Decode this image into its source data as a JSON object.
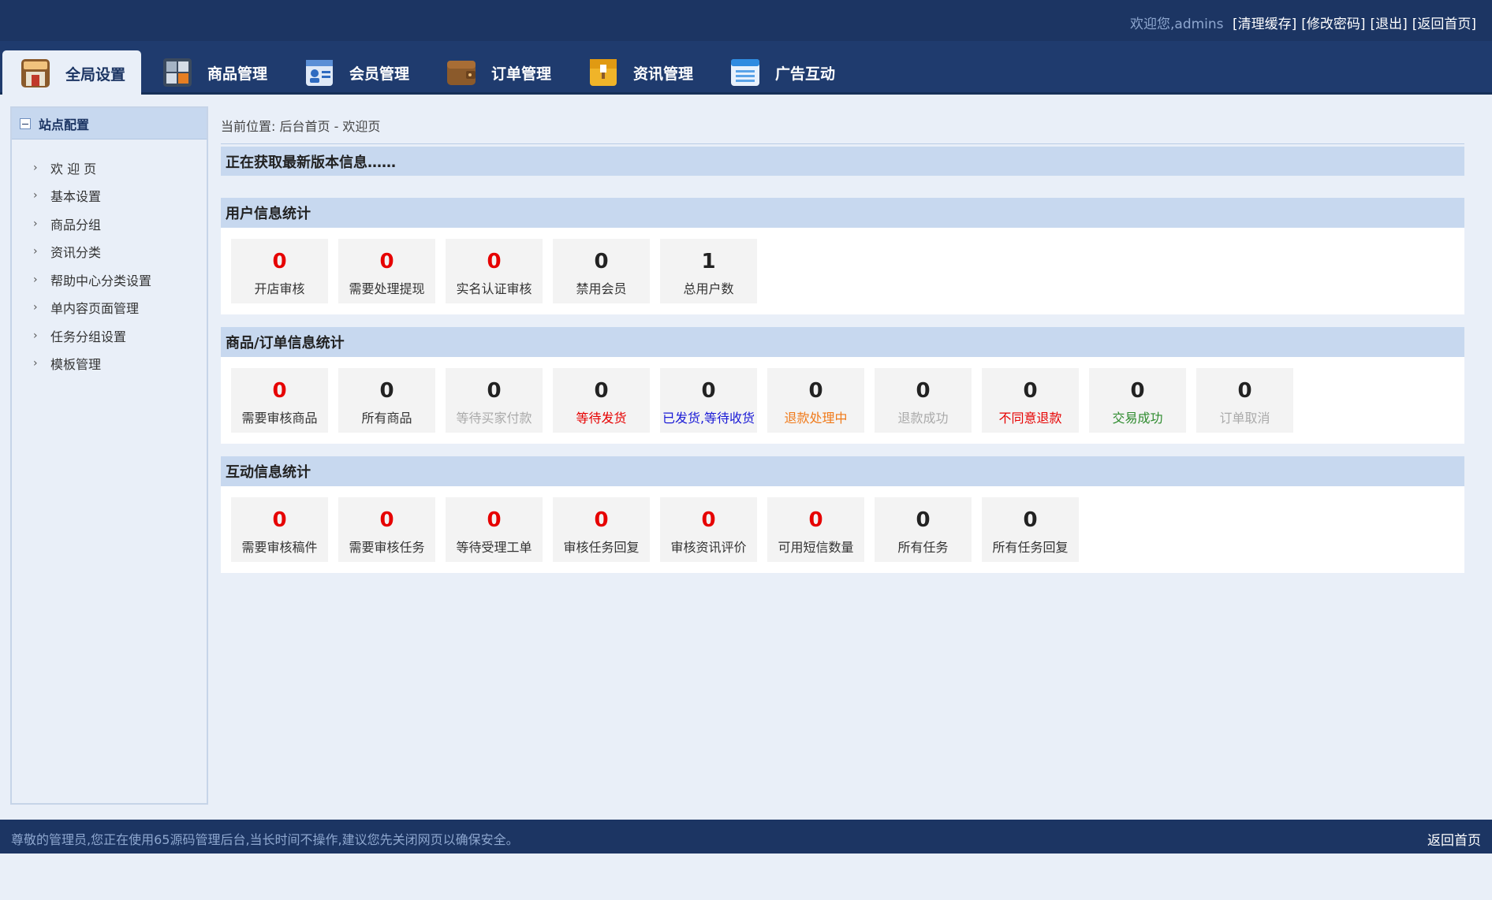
{
  "topbar": {
    "welcome": "欢迎您,",
    "username": "admins",
    "links": [
      "[清理缓存]",
      "[修改密码]",
      "[退出]",
      "[返回首页]"
    ]
  },
  "nav": {
    "tabs": [
      {
        "label": "全局设置",
        "icon": "home-icon",
        "active": true
      },
      {
        "label": "商品管理",
        "icon": "grid-icon",
        "active": false
      },
      {
        "label": "会员管理",
        "icon": "member-card-icon",
        "active": false
      },
      {
        "label": "订单管理",
        "icon": "wallet-icon",
        "active": false
      },
      {
        "label": "资讯管理",
        "icon": "folder-icon",
        "active": false
      },
      {
        "label": "广告互动",
        "icon": "window-icon",
        "active": false
      }
    ]
  },
  "sidebar": {
    "title": "站点配置",
    "items": [
      "欢 迎 页",
      "基本设置",
      "商品分组",
      "资讯分类",
      "帮助中心分类设置",
      "单内容页面管理",
      "任务分组设置",
      "模板管理"
    ]
  },
  "main": {
    "breadcrumb": "当前位置:  后台首页 - 欢迎页",
    "version_notice": "正在获取最新版本信息……",
    "sections": [
      {
        "title": "用户信息统计",
        "stats": [
          {
            "value": "0",
            "label": "开店审核",
            "value_color": "#e60000",
            "label_color": "#333333"
          },
          {
            "value": "0",
            "label": "需要处理提现",
            "value_color": "#e60000",
            "label_color": "#333333"
          },
          {
            "value": "0",
            "label": "实名认证审核",
            "value_color": "#e60000",
            "label_color": "#333333"
          },
          {
            "value": "0",
            "label": "禁用会员",
            "value_color": "#222222",
            "label_color": "#333333"
          },
          {
            "value": "1",
            "label": "总用户数",
            "value_color": "#222222",
            "label_color": "#333333"
          }
        ]
      },
      {
        "title": "商品/订单信息统计",
        "stats": [
          {
            "value": "0",
            "label": "需要审核商品",
            "value_color": "#e60000",
            "label_color": "#333333"
          },
          {
            "value": "0",
            "label": "所有商品",
            "value_color": "#222222",
            "label_color": "#333333"
          },
          {
            "value": "0",
            "label": "等待买家付款",
            "value_color": "#222222",
            "label_color": "#aaaaaa"
          },
          {
            "value": "0",
            "label": "等待发货",
            "value_color": "#222222",
            "label_color": "#e60000"
          },
          {
            "value": "0",
            "label": "已发货,等待收货",
            "value_color": "#222222",
            "label_color": "#1a1ad6"
          },
          {
            "value": "0",
            "label": "退款处理中",
            "value_color": "#222222",
            "label_color": "#f07a1a"
          },
          {
            "value": "0",
            "label": "退款成功",
            "value_color": "#222222",
            "label_color": "#aaaaaa"
          },
          {
            "value": "0",
            "label": "不同意退款",
            "value_color": "#222222",
            "label_color": "#e60000"
          },
          {
            "value": "0",
            "label": "交易成功",
            "value_color": "#222222",
            "label_color": "#2e8b2e"
          },
          {
            "value": "0",
            "label": "订单取消",
            "value_color": "#222222",
            "label_color": "#aaaaaa"
          }
        ]
      },
      {
        "title": "互动信息统计",
        "stats": [
          {
            "value": "0",
            "label": "需要审核稿件",
            "value_color": "#e60000",
            "label_color": "#333333"
          },
          {
            "value": "0",
            "label": "需要审核任务",
            "value_color": "#e60000",
            "label_color": "#333333"
          },
          {
            "value": "0",
            "label": "等待受理工单",
            "value_color": "#e60000",
            "label_color": "#333333"
          },
          {
            "value": "0",
            "label": "审核任务回复",
            "value_color": "#e60000",
            "label_color": "#333333"
          },
          {
            "value": "0",
            "label": "审核资讯评价",
            "value_color": "#e60000",
            "label_color": "#333333"
          },
          {
            "value": "0",
            "label": "可用短信数量",
            "value_color": "#e60000",
            "label_color": "#333333"
          },
          {
            "value": "0",
            "label": "所有任务",
            "value_color": "#222222",
            "label_color": "#333333"
          },
          {
            "value": "0",
            "label": "所有任务回复",
            "value_color": "#222222",
            "label_color": "#333333"
          }
        ]
      }
    ]
  },
  "footer": {
    "note": "尊敬的管理员,您正在使用65源码管理后台,当长时间不操作,建议您先关闭网页以确保安全。",
    "home_link": "返回首页"
  }
}
